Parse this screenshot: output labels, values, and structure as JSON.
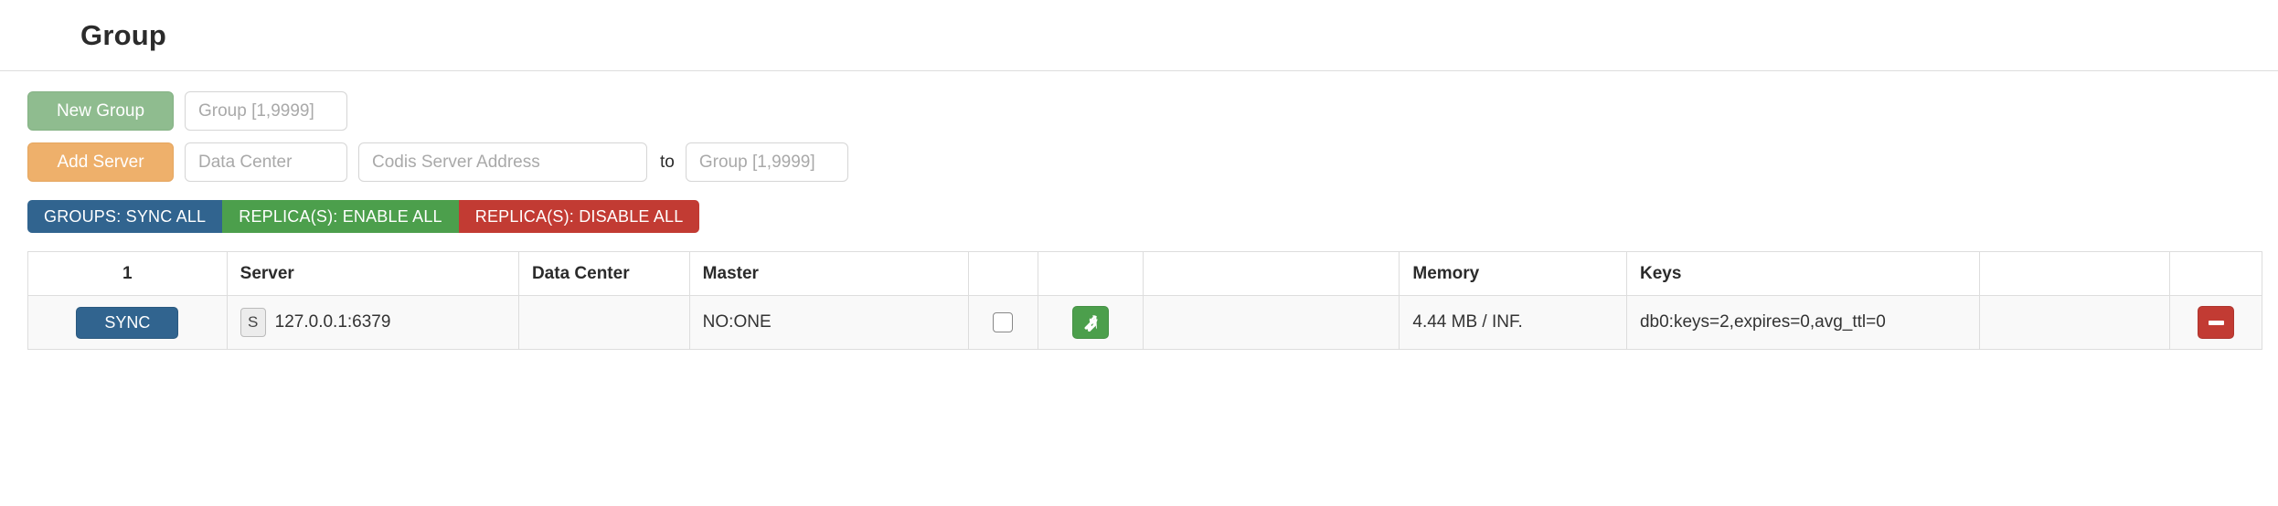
{
  "header": {
    "title": "Group"
  },
  "forms": {
    "new_group": {
      "button_label": "New Group",
      "group_placeholder": "Group [1,9999]",
      "group_value": ""
    },
    "add_server": {
      "button_label": "Add Server",
      "datacenter_placeholder": "Data Center",
      "datacenter_value": "",
      "address_placeholder": "Codis Server Address",
      "address_value": "",
      "to_label": "to",
      "to_group_placeholder": "Group [1,9999]",
      "to_group_value": ""
    }
  },
  "action_bar": {
    "buttons": [
      {
        "label": "GROUPS: SYNC ALL",
        "color": "#31648f"
      },
      {
        "label": "REPLICA(S): ENABLE ALL",
        "color": "#4c9f4c"
      },
      {
        "label": "REPLICA(S): DISABLE ALL",
        "color": "#c23b33"
      }
    ]
  },
  "table": {
    "headers": {
      "index": "1",
      "server": "Server",
      "data_center": "Data Center",
      "master": "Master",
      "check": "",
      "wrench": "",
      "blank": "",
      "memory": "Memory",
      "keys": "Keys",
      "spacer": "",
      "delete": ""
    },
    "rows": [
      {
        "sync_label": "SYNC",
        "role_badge": "S",
        "server": "127.0.0.1:6379",
        "data_center": "",
        "master": "NO:ONE",
        "blank": "",
        "memory": "4.44 MB / INF.",
        "keys": "db0:keys=2,expires=0,avg_ttl=0",
        "spacer": ""
      }
    ]
  },
  "icons": {
    "wrench": "wrench-icon",
    "minus": "minus-icon",
    "checkbox": "checkbox-unchecked-icon"
  },
  "colors": {
    "new_group": "#8fbc8f",
    "add_server": "#eeb06b",
    "primary": "#31648f",
    "success": "#4c9f4c",
    "danger": "#c23b33"
  }
}
